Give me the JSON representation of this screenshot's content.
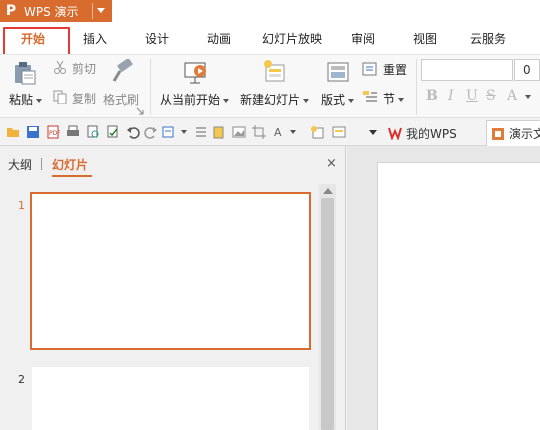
{
  "app": {
    "logo": "P",
    "name": "WPS 演示"
  },
  "tabs": [
    {
      "label": "开始",
      "active": true
    },
    {
      "label": "插入"
    },
    {
      "label": "设计"
    },
    {
      "label": "动画"
    },
    {
      "label": "幻灯片放映"
    },
    {
      "label": "审阅"
    },
    {
      "label": "视图"
    },
    {
      "label": "云服务"
    }
  ],
  "ribbon": {
    "clipboard": {
      "paste": "粘贴",
      "cut": "剪切",
      "copy": "复制",
      "format_painter": "格式刷"
    },
    "slides": {
      "play_from_current": "从当前开始",
      "new_slide": "新建幻灯片",
      "layout": "版式",
      "reset": "重置",
      "section": "节"
    },
    "font": {
      "font_name": "",
      "font_size": "0",
      "bold": "B",
      "italic": "I",
      "underline": "U",
      "strike": "S",
      "color": "A"
    }
  },
  "doc_tabs": {
    "my_wps": "我的WPS",
    "presentation": "演示文"
  },
  "panel": {
    "tabs": {
      "outline": "大纲",
      "slides": "幻灯片"
    },
    "close": "×",
    "slides": [
      {
        "number": "1",
        "selected": true
      },
      {
        "number": "2",
        "selected": false
      }
    ]
  },
  "colors": {
    "accent": "#d86b2e",
    "highlight_box": "#e53935"
  }
}
